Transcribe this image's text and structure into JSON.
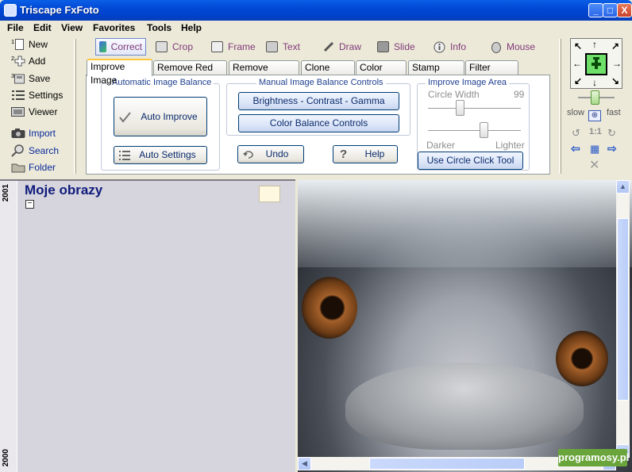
{
  "window": {
    "title": "Triscape FxFoto",
    "min": "_",
    "max": "□",
    "close": "X"
  },
  "menu": [
    "File",
    "Edit",
    "View",
    "Favorites",
    "Tools",
    "Help"
  ],
  "left_commands": [
    {
      "num": "1",
      "label": "New"
    },
    {
      "num": "2",
      "label": "Add"
    },
    {
      "num": "3",
      "label": "Save"
    },
    {
      "num": "",
      "label": "Settings"
    },
    {
      "num": "",
      "label": "Viewer"
    },
    {
      "num": "",
      "label": "Import"
    },
    {
      "num": "",
      "label": "Search"
    },
    {
      "num": "",
      "label": "Folder"
    }
  ],
  "mode_tabs": [
    "Correct",
    "Crop",
    "Frame",
    "Text",
    "Draw",
    "Slide",
    "Info",
    "Mouse"
  ],
  "sub_tabs": [
    "Improve Image",
    "Remove Red Eye",
    "Remove Blemish",
    "Clone Brush",
    "Color Brush",
    "Stamp Brush",
    "Filter Effects"
  ],
  "panel": {
    "auto_group": "Automatic Image Balance",
    "auto_improve": "Auto Improve",
    "auto_settings": "Auto Settings",
    "manual_group": "Manual Image Balance Controls",
    "bcg": "Brightness - Contrast - Gamma",
    "color_balance": "Color Balance Controls",
    "undo": "Undo",
    "help": "Help",
    "area_group": "Improve Image Area",
    "circle_width": "Circle Width",
    "circle_value": "99",
    "darker": "Darker",
    "lighter": "Lighter",
    "circle_tool": "Use Circle Click Tool"
  },
  "speed": {
    "slow": "slow",
    "fast": "fast",
    "one_to_one": "1:1"
  },
  "folder": {
    "title": "Moje obrazy",
    "year_top": "2001",
    "year_bottom": "2000",
    "collapse": "−"
  },
  "watermark": "programosy.pl"
}
